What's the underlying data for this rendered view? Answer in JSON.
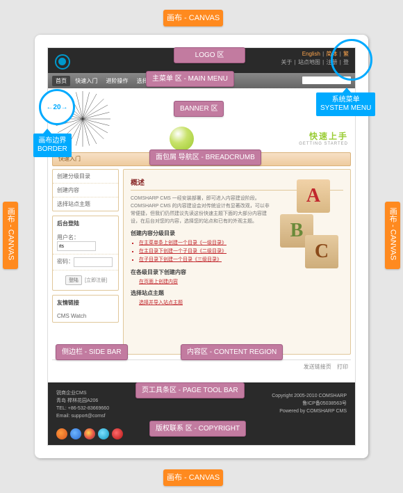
{
  "annotations": {
    "canvas": "画布 - CANVAS",
    "logo": "LOGO 区",
    "mainmenu": "主菜单 区 - MAIN MENU",
    "systemmenu_l1": "系统菜单",
    "systemmenu_l2": "SYSTEM MENU",
    "banner": "BANNER 区",
    "border_l1": "画布边界",
    "border_l2": "BORDER",
    "border_width": "←20→",
    "breadcrumb": "面包屑 导航区 - BREADCRUMB",
    "sidebar": "侧边栏 - SIDE BAR",
    "content": "内容区 - CONTENT REGION",
    "pagetool": "页工具条区 - PAGE TOOL BAR",
    "copyright": "版权联系 区 - COPYRIGHT"
  },
  "systembar": {
    "line1": [
      "English",
      "简体",
      "繁"
    ],
    "line2": [
      "关于",
      "站点地图",
      "注册",
      "登"
    ]
  },
  "menu": {
    "items": [
      "首页",
      "快速入门",
      "进阶操作",
      "选择我们"
    ]
  },
  "getting_started": {
    "cn": "快速上手",
    "en": "GETTING STARTED"
  },
  "breadcrumb_text": "快速入门",
  "sidebar": {
    "nav": [
      "创建分级目录",
      "创建内容",
      "选择站点主题"
    ],
    "login_title": "后台登陆",
    "user_label": "用户名：",
    "user_value": "its",
    "pwd_label": "密码：",
    "btn_login": "登陆",
    "btn_register": "[立即注册]",
    "links_title": "友情链接",
    "links": [
      "CMS Watch"
    ]
  },
  "content": {
    "title": "概述",
    "intro": "COMSHARP CMS 一经安装部署，即可进入内容建设阶段。COMSHARP CMS 的内容建设会对传统设计有显著改观，可以非常便捷，但我们仍然建议先读这份快速主题下面的大部分内容建设，在后台对您的内容，选择您的站点和已有的外观主题。",
    "h1": "创建内容分级目录",
    "list1": [
      "在主菜单条上创建一个目录《一级目录》",
      "在主目录下创建一个子目录《二级目录》",
      "在子目录下创建一个目录《三级目录》"
    ],
    "h2": "在各级目录下创建内容",
    "link2": "在页面上创建内容",
    "h3": "选择站点主题",
    "link3": "选择并导入站点主题"
  },
  "pagetools": {
    "feedback": "发送链接页",
    "print": "打印"
  },
  "footer": {
    "col1": [
      "锐商企业CMS",
      "青岛 榉林花园A206",
      "TEL: +86-532-83669660",
      "Email: support@comsf"
    ],
    "col2": [
      "Copyright 2005-2010 COMSHARP",
      "鲁ICP备05038563号",
      "Powered by COMSHARP CMS"
    ]
  },
  "abc": {
    "a": "A",
    "b": "B",
    "c": "C"
  }
}
